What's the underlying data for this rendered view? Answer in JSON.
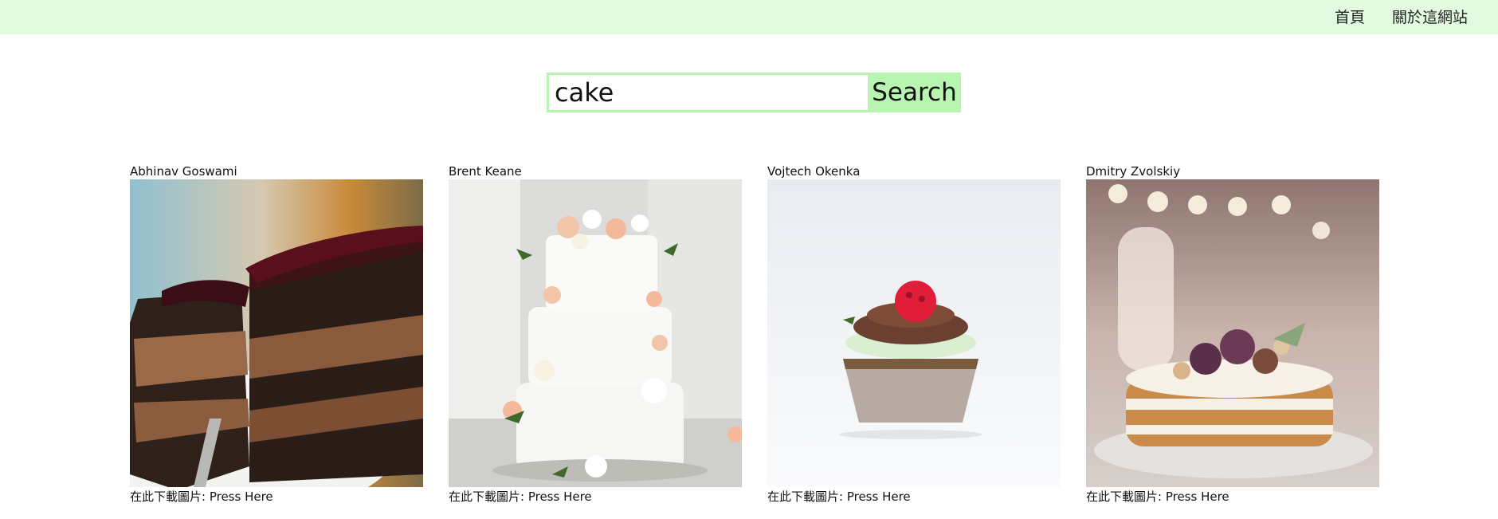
{
  "nav": {
    "home_label": "首頁",
    "about_label": "關於這網站"
  },
  "search": {
    "value": "cake",
    "button_label": "Search"
  },
  "results": [
    {
      "author": "Abhinav Goswami",
      "download_prefix": "在此下載圖片: ",
      "download_link": "Press Here",
      "image": "chocolate-layer-cake-slice"
    },
    {
      "author": "Brent Keane",
      "download_prefix": "在此下載圖片: ",
      "download_link": "Press Here",
      "image": "white-tiered-wedding-cake-with-flowers"
    },
    {
      "author": "Vojtech Okenka",
      "download_prefix": "在此下載圖片: ",
      "download_link": "Press Here",
      "image": "cupcake-with-raspberry"
    },
    {
      "author": "Dmitry Zvolskiy",
      "download_prefix": "在此下載圖片: ",
      "download_link": "Press Here",
      "image": "naked-cake-with-figs"
    }
  ],
  "colors": {
    "topbar": "#e2fbe0",
    "search_accent": "#b7f5b0"
  }
}
